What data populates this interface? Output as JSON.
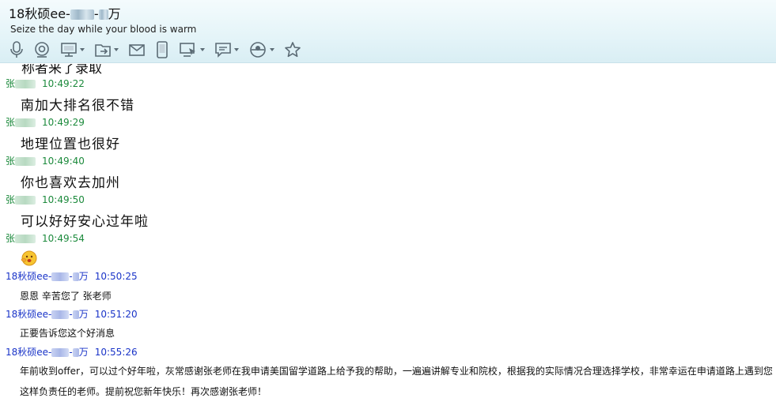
{
  "window": {
    "title_prefix": "18秋硕ee-",
    "title_suffix": "-",
    "title_end": "万",
    "signature": "Seize the day while your blood is warm"
  },
  "toolbar": {
    "items": [
      {
        "icon": "microphone-icon"
      },
      {
        "icon": "video-call-icon"
      },
      {
        "icon": "screen-share-icon",
        "dropdown": true
      },
      {
        "icon": "file-transfer-icon",
        "dropdown": true
      },
      {
        "icon": "email-icon"
      },
      {
        "icon": "mobile-icon"
      },
      {
        "icon": "remote-assist-icon",
        "dropdown": true
      },
      {
        "icon": "message-icon",
        "dropdown": true
      },
      {
        "icon": "app-center-icon",
        "dropdown": true
      },
      {
        "icon": "star-icon"
      }
    ]
  },
  "chat": {
    "partial_top": "称者来了录取",
    "teacher_name": "张",
    "me_name_prefix": "18秋硕ee-",
    "me_name_end": "万",
    "messages": [
      {
        "time": "10:49:22",
        "text": "南加大排名很不错"
      },
      {
        "time": "10:49:29",
        "text": "地理位置也很好"
      },
      {
        "time": "10:49:40",
        "text": "你也喜欢去加州"
      },
      {
        "time": "10:49:50",
        "text": "可以好好安心过年啦"
      },
      {
        "time": "10:49:54"
      },
      {
        "time": "10:50:25",
        "text": "恩恩 辛苦您了 张老师"
      },
      {
        "time": "10:51:20",
        "text": "正要告诉您这个好消息"
      },
      {
        "time": "10:55:26",
        "text": "年前收到offer，可以过个好年啦，灰常感谢张老师在我申请美国留学道路上给予我的帮助，一遍遍讲解专业和院校，根据我的实际情况合理选择学校，非常幸运在申请道路上遇到您这样负责任的老师。提前祝您新年快乐！再次感谢张老师！"
      }
    ]
  },
  "colors": {
    "teacher_name": "#1c8a3c",
    "my_name": "#1a34c8",
    "header_bg": "#e4f4f8"
  }
}
